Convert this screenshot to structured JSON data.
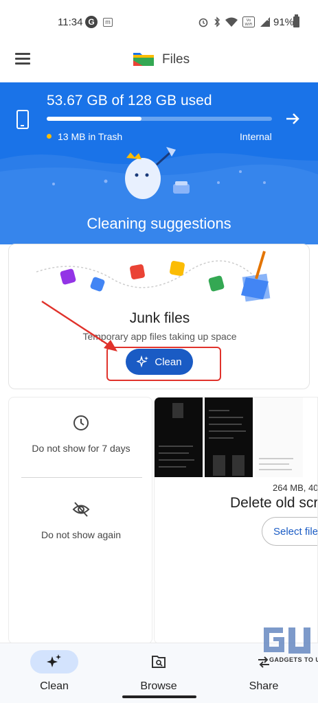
{
  "status_bar": {
    "time": "11:34",
    "battery": "91%"
  },
  "app_bar": {
    "title": "Files"
  },
  "storage": {
    "summary": "53.67 GB of 128 GB used",
    "used_fraction": 0.42,
    "trash": "13 MB in Trash",
    "location": "Internal"
  },
  "suggestions": {
    "title": "Cleaning suggestions"
  },
  "junk_card": {
    "title": "Junk files",
    "subtitle": "Temporary app files taking up space",
    "button": "Clean"
  },
  "options": {
    "snooze_label": "Do not show for 7 days",
    "hide_label": "Do not show again"
  },
  "old_screenshots": {
    "size": "264 MB, 40",
    "title": "Delete old scr",
    "button": "Select file"
  },
  "bottom_nav": {
    "items": [
      {
        "label": "Clean",
        "icon": "sparkle-icon",
        "active": true
      },
      {
        "label": "Browse",
        "icon": "browse-icon",
        "active": false
      },
      {
        "label": "Share",
        "icon": "share-icon",
        "active": false
      }
    ]
  },
  "watermark": {
    "text": "GADGETS TO USE"
  },
  "colors": {
    "primary_blue": "#1a73e8",
    "button_blue": "#1a5bc4",
    "annotation_red": "#e0322b",
    "nav_active": "#d3e3fd"
  }
}
